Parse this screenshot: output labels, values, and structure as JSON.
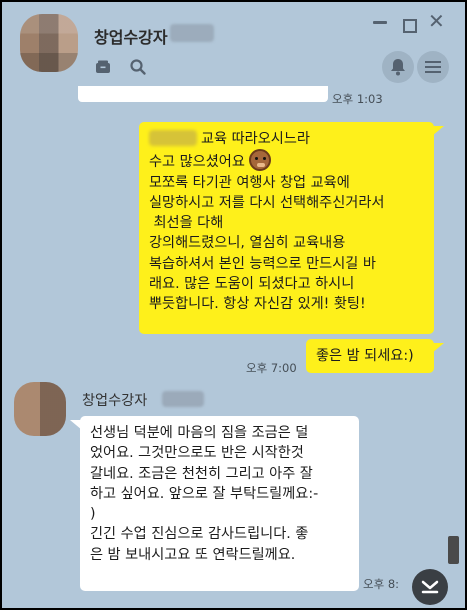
{
  "header": {
    "title": "창업수강자",
    "icons": {
      "box": "box-icon",
      "search": "search-icon",
      "bell": "bell-icon",
      "menu": "menu-icon"
    },
    "window_controls": {
      "close": "✕"
    }
  },
  "messages": {
    "prev_time": "오후 1:03",
    "me1": {
      "lines": [
        "교육 따라오시느라",
        "수고 많으셨어요",
        "모쪼록 타기관 여행사 창업 교육에",
        "실망하시고 저를 다시 선택해주신거라서",
        " 최선을 다해",
        "강의해드렸으니, 열심히 교육내용",
        "복습하셔서 본인 능력으로 만드시길 바",
        "래요. 많은 도움이 되셨다고 하시니",
        "뿌듯합니다. 항상 자신감 있게! 홧팅!"
      ]
    },
    "me2": {
      "time": "오후 7:00",
      "text": "좋은 밤 되세요:)"
    },
    "them1": {
      "sender": "창업수강자",
      "lines": [
        "선생님 덕분에 마음의 짐을 조금은 덜",
        "었어요. 그것만으로도 반은 시작한것",
        "갈네요. 조금은 천천히 그리고 아주 잘",
        "하고 싶어요. 앞으로 잘 부탁드릴께요:-",
        ")",
        "",
        "긴긴 수업 진심으로 감사드립니다. 좋",
        "은 밤 보내시고요 또 연락드릴께요."
      ],
      "time": "오후 8:"
    }
  },
  "colors": {
    "bg": "#b2c7d9",
    "me_bubble": "#fef01b",
    "them_bubble": "#ffffff"
  }
}
